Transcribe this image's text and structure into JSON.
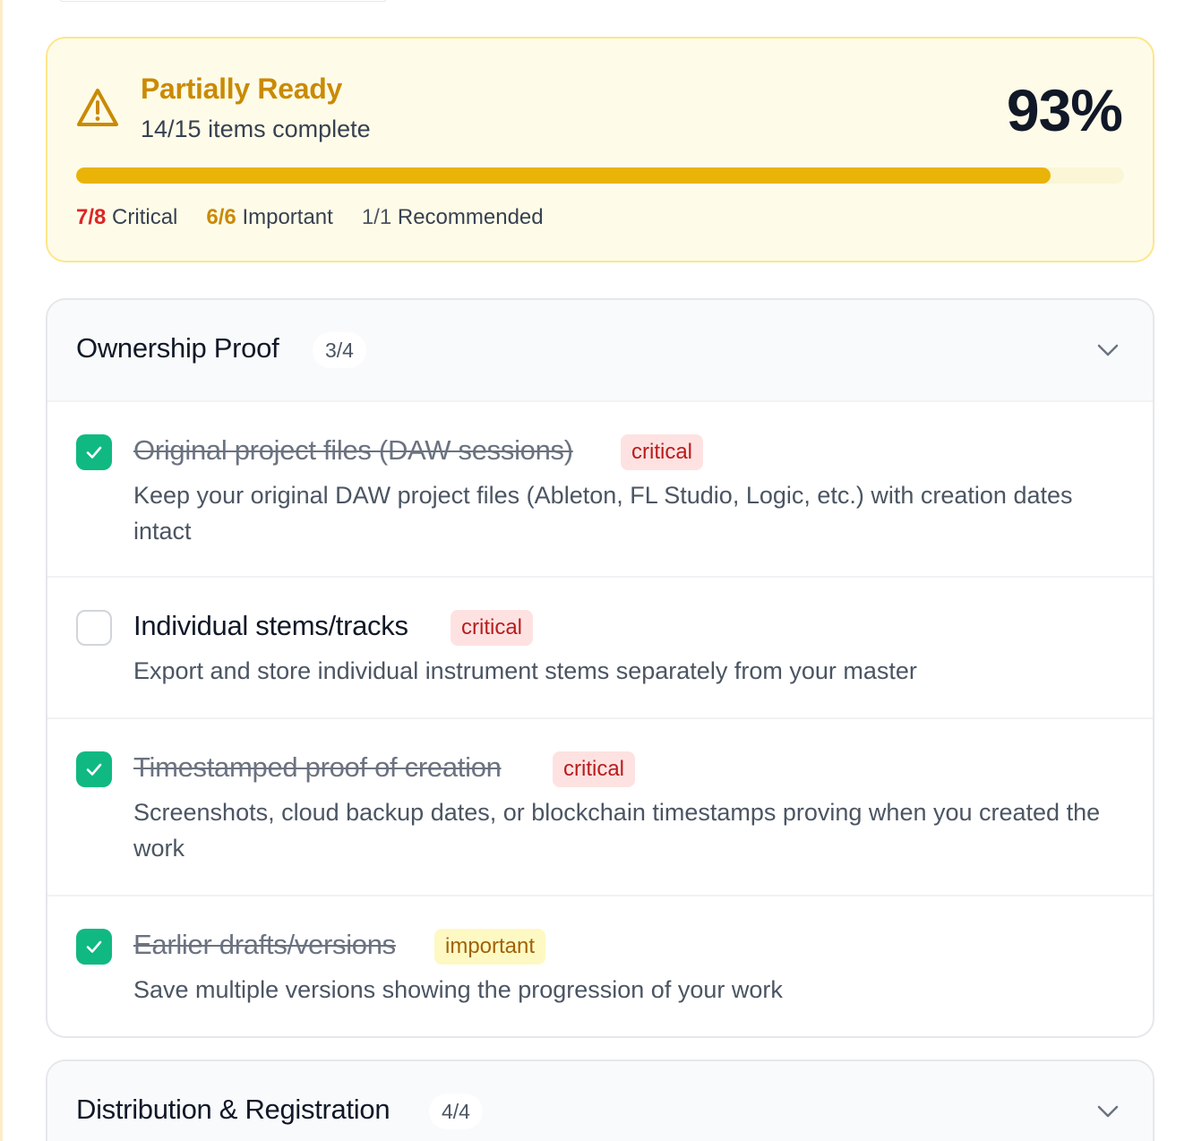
{
  "summary": {
    "status": "Partially Ready",
    "subtitle": "14/15 items complete",
    "percent_text": "93%",
    "progress": 0.93,
    "counts": {
      "critical_value": "7/8",
      "critical_label": "Critical",
      "important_value": "6/6",
      "important_label": "Important",
      "recommended_value": "1/1",
      "recommended_label": "Recommended"
    },
    "icon": "warning-triangle-icon",
    "accent": "#ca8a04"
  },
  "sections": [
    {
      "title": "Ownership Proof",
      "count": "3/4",
      "icon": "chevron-down-icon",
      "items": [
        {
          "title": "Original project files (DAW sessions)",
          "tag": "critical",
          "checked": true,
          "description": "Keep your original DAW project files (Ableton, FL Studio, Logic, etc.) with creation dates intact"
        },
        {
          "title": "Individual stems/tracks",
          "tag": "critical",
          "checked": false,
          "description": "Export and store individual instrument stems separately from your master"
        },
        {
          "title": "Timestamped proof of creation",
          "tag": "critical",
          "checked": true,
          "description": "Screenshots, cloud backup dates, or blockchain timestamps proving when you created the work"
        },
        {
          "title": "Earlier drafts/versions",
          "tag": "important",
          "checked": true,
          "description": "Save multiple versions showing the progression of your work"
        }
      ]
    },
    {
      "title": "Distribution & Registration",
      "count": "4/4",
      "icon": "chevron-down-icon"
    }
  ],
  "colors": {
    "check_green": "#10b981",
    "critical_red": "#dc2626",
    "important_amber": "#ca8a04"
  }
}
